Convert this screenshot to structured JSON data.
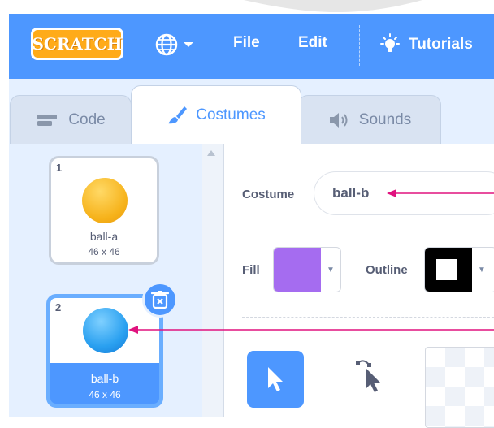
{
  "menubar": {
    "logo": "SCRATCH",
    "items": [
      "File",
      "Edit"
    ],
    "tutorials": "Tutorials"
  },
  "tabs": [
    {
      "label": "Code",
      "icon": "code-blocks-icon",
      "active": false
    },
    {
      "label": "Costumes",
      "icon": "paintbrush-icon",
      "active": true
    },
    {
      "label": "Sounds",
      "icon": "speaker-icon",
      "active": false
    }
  ],
  "costumes": [
    {
      "number": "1",
      "name": "ball-a",
      "size": "46 x 46",
      "color": "#f6b21a",
      "selected": false
    },
    {
      "number": "2",
      "name": "ball-b",
      "size": "46 x 46",
      "color": "#2aa0f0",
      "selected": true
    }
  ],
  "editor": {
    "costume_label": "Costume",
    "costume_name": "ball-b",
    "fill_label": "Fill",
    "fill_color": "#a56cf0",
    "outline_label": "Outline",
    "outline_color": "#000000"
  },
  "colors": {
    "accent": "#4d97ff",
    "annotation_arrow": "#e0127e"
  }
}
